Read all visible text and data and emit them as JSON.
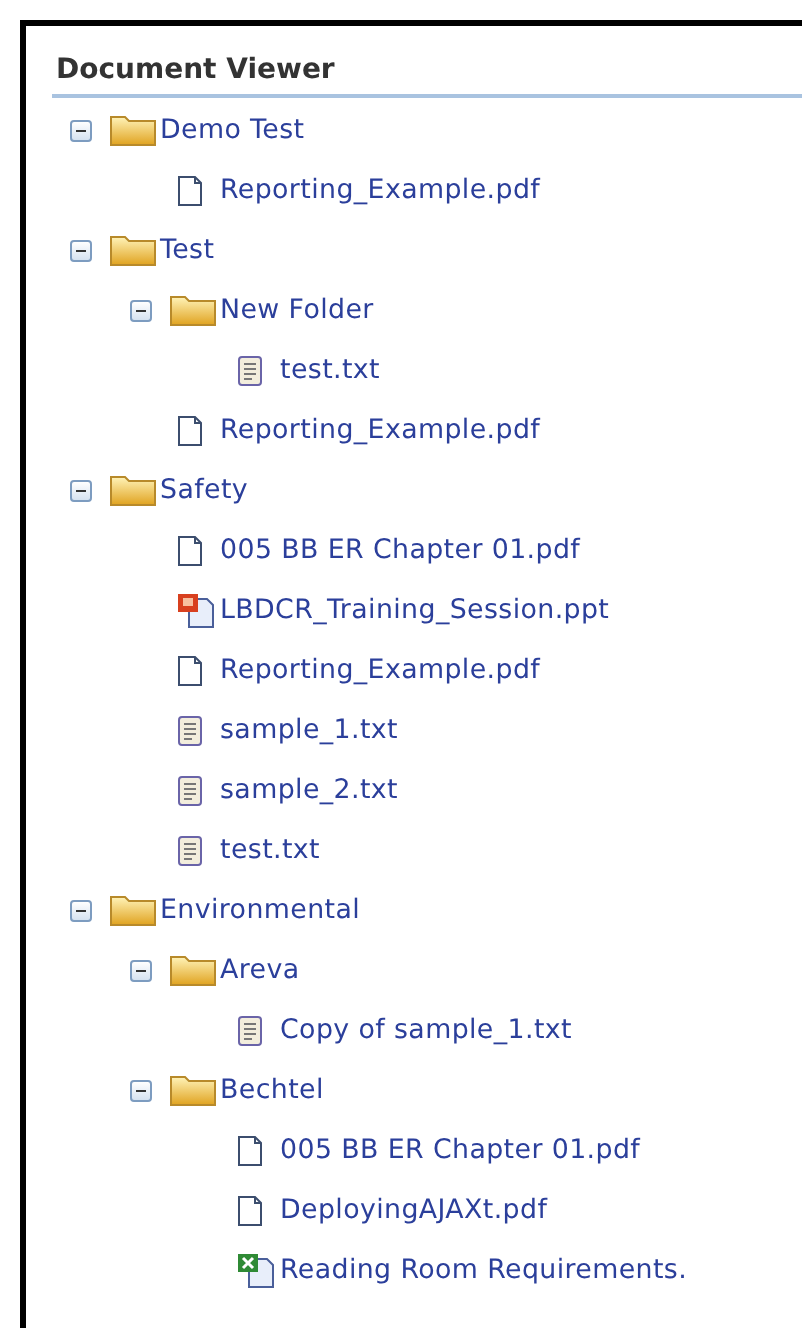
{
  "title": "Document Viewer",
  "tree": [
    {
      "kind": "folder",
      "label": "Demo Test",
      "expanded": true,
      "children": [
        {
          "kind": "pdf",
          "label": "Reporting_Example.pdf"
        }
      ]
    },
    {
      "kind": "folder",
      "label": "Test",
      "expanded": true,
      "children": [
        {
          "kind": "folder",
          "label": "New Folder",
          "expanded": true,
          "children": [
            {
              "kind": "txt",
              "label": "test.txt"
            }
          ]
        },
        {
          "kind": "pdf",
          "label": "Reporting_Example.pdf"
        }
      ]
    },
    {
      "kind": "folder",
      "label": "Safety",
      "expanded": true,
      "children": [
        {
          "kind": "pdf",
          "label": "005 BB ER Chapter 01.pdf"
        },
        {
          "kind": "ppt",
          "label": "LBDCR_Training_Session.ppt"
        },
        {
          "kind": "pdf",
          "label": "Reporting_Example.pdf"
        },
        {
          "kind": "txt",
          "label": "sample_1.txt"
        },
        {
          "kind": "txt",
          "label": "sample_2.txt"
        },
        {
          "kind": "txt",
          "label": "test.txt"
        }
      ]
    },
    {
      "kind": "folder",
      "label": "Environmental",
      "expanded": true,
      "children": [
        {
          "kind": "folder",
          "label": "Areva",
          "expanded": true,
          "children": [
            {
              "kind": "txt",
              "label": "Copy of sample_1.txt"
            }
          ]
        },
        {
          "kind": "folder",
          "label": "Bechtel",
          "expanded": true,
          "children": [
            {
              "kind": "pdf",
              "label": "005 BB ER Chapter 01.pdf"
            },
            {
              "kind": "pdf",
              "label": "DeployingAJAXt.pdf"
            },
            {
              "kind": "xls",
              "label": "Reading Room Requirements."
            }
          ]
        }
      ]
    }
  ]
}
